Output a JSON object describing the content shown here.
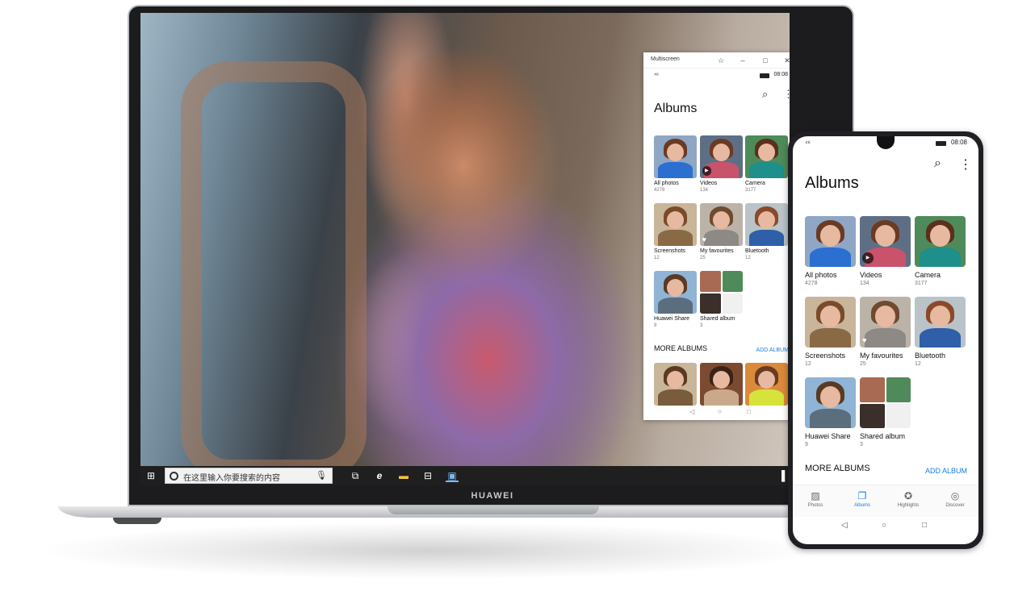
{
  "desktop": {
    "taskbar": {
      "search_placeholder": "在这里输入你要搜索的内容"
    },
    "brand": "HUAWEI"
  },
  "multiscreen": {
    "window_title": "Multiscreen",
    "status": {
      "signal": "⁴⁶",
      "time": "08:08"
    },
    "heading": "Albums",
    "albums": [
      {
        "name": "All photos",
        "count": "4278"
      },
      {
        "name": "Videos",
        "count": "134"
      },
      {
        "name": "Camera",
        "count": "3177"
      },
      {
        "name": "Screenshots",
        "count": "12"
      },
      {
        "name": "My favourites",
        "count": "25"
      },
      {
        "name": "Bluetooth",
        "count": "12"
      },
      {
        "name": "Huawei Share",
        "count": "9"
      },
      {
        "name": "Shared album",
        "count": "3"
      }
    ],
    "more_albums_label": "MORE ALBUMS",
    "add_album_label": "ADD ALBUM"
  },
  "phone": {
    "status": {
      "signal": "⁴⁶",
      "time": "08:08"
    },
    "heading": "Albums",
    "albums": [
      {
        "name": "All photos",
        "count": "4278"
      },
      {
        "name": "Videos",
        "count": "134"
      },
      {
        "name": "Camera",
        "count": "3177"
      },
      {
        "name": "Screenshots",
        "count": "12"
      },
      {
        "name": "My favourites",
        "count": "25"
      },
      {
        "name": "Bluetooth",
        "count": "12"
      },
      {
        "name": "Huawei Share",
        "count": "9"
      },
      {
        "name": "Shared album",
        "count": "3"
      }
    ],
    "more_albums_label": "MORE ALBUMS",
    "add_album_label": "ADD ALBUM",
    "tabs": [
      {
        "label": "Photos",
        "icon": "image-icon"
      },
      {
        "label": "Albums",
        "icon": "albums-icon",
        "active": true
      },
      {
        "label": "Highlights",
        "icon": "star-icon"
      },
      {
        "label": "Discover",
        "icon": "compass-icon"
      }
    ]
  },
  "colors": {
    "accent": "#1a7ee6",
    "taskbar": "#1f1f1f"
  }
}
